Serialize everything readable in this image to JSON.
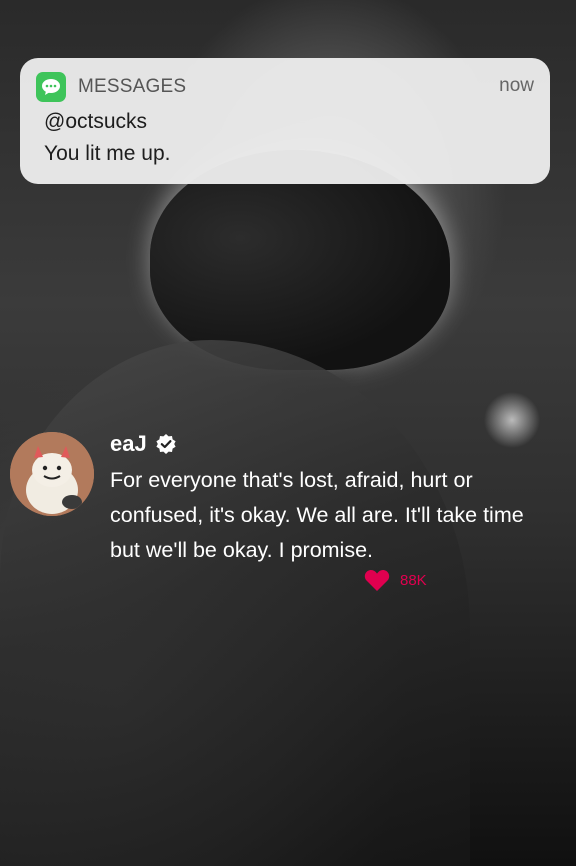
{
  "notification": {
    "app_name": "MESSAGES",
    "time": "now",
    "sender": "@octsucks",
    "message": "You lit me up.",
    "app_icon": "message-bubble-icon",
    "accent": "#3ec45a"
  },
  "tweet": {
    "author": "eaJ",
    "verified_icon": "verified-badge-icon",
    "text": "For everyone that's lost, afraid, hurt or confused, it's okay. We all are. It'll take time but we'll be okay. I promise.",
    "like_icon": "heart-icon",
    "like_count": "88K",
    "like_color": "#e0004f"
  }
}
